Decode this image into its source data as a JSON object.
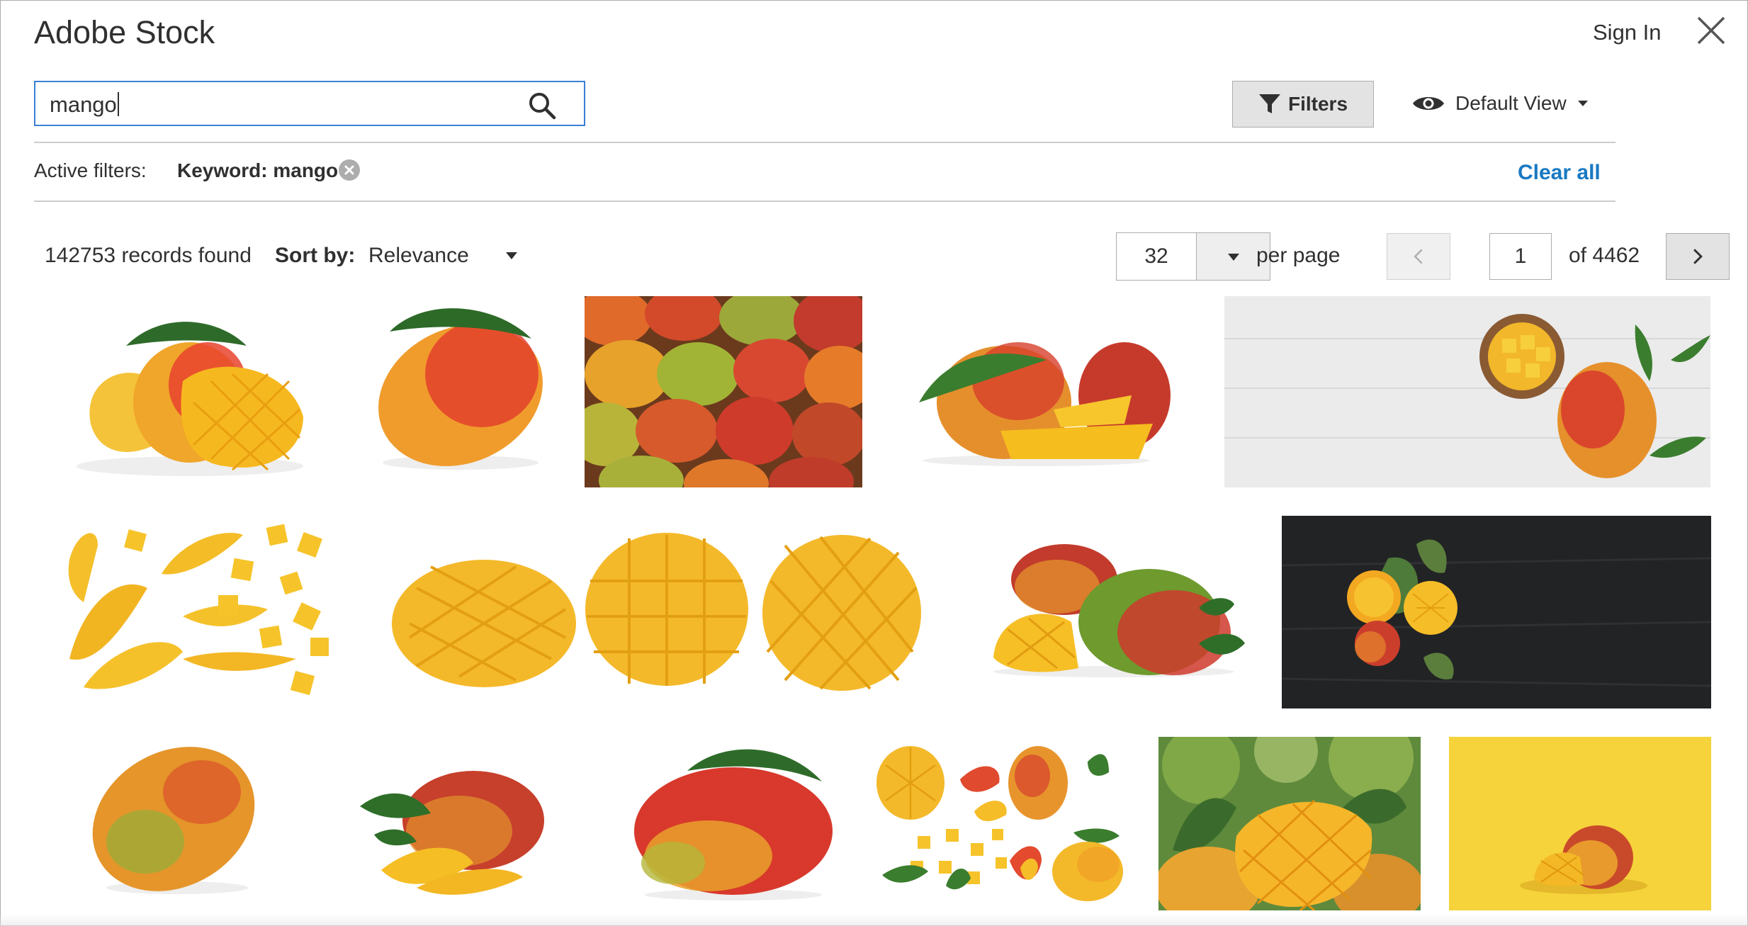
{
  "modal": {
    "title": "Adobe Stock",
    "sign_in": "Sign In"
  },
  "search": {
    "value": "mango"
  },
  "toolbar": {
    "filters_label": "Filters",
    "view_label": "Default View"
  },
  "active_filters": {
    "label": "Active filters:",
    "chips": [
      "Keyword: mango"
    ],
    "clear_all": "Clear all"
  },
  "results": {
    "records_found": "142753 records found",
    "sort_label": "Sort by:",
    "sort_value": "Relevance"
  },
  "pagination": {
    "per_page_value": "32",
    "per_page_label": "per page",
    "current_page": "1",
    "total_pages_label": "of 4462"
  },
  "colors": {
    "accent": "#1979c3",
    "search_border": "#3a7fd5",
    "button_bg": "#e3e3e3"
  },
  "grid": {
    "images": [
      "mango-with-cut-half-on-white",
      "whole-mango-with-leaf",
      "pile-of-mangoes",
      "mangoes-with-slices-and-leaf",
      "mango-and-bowl-of-cubes-on-white-wood",
      "mango-slices-and-cubes",
      "three-hedgehog-cut-mangoes",
      "mangoes-with-hedgehog-half-and-leaves",
      "mangoes-on-dark-wood",
      "whole-ripe-mango",
      "mango-with-slices-and-leaves",
      "mango-with-leaf-on-top",
      "mango-pieces-collage",
      "hedgehog-mango-in-garden",
      "mango-on-yellow-background"
    ]
  },
  "icons": {
    "search": "search-icon",
    "close": "close-icon",
    "filter": "filter-funnel-icon",
    "eye": "eye-icon"
  }
}
